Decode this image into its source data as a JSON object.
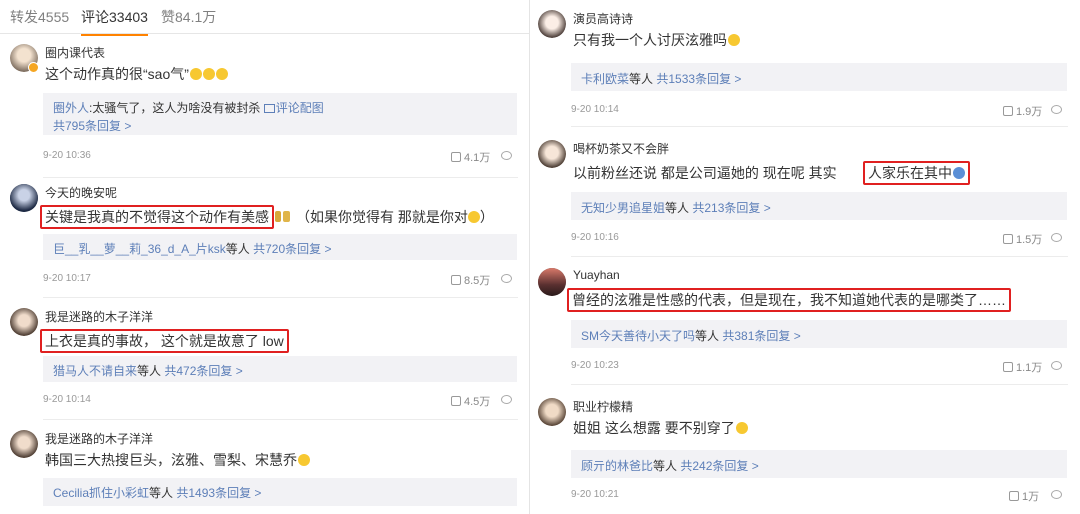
{
  "tabs": [
    {
      "label": "转发4555"
    },
    {
      "label": "评论33403"
    },
    {
      "label": "赞84.1万"
    }
  ],
  "left_comments": [
    {
      "user": "圈内课代表",
      "text": "这个动作真的很“sao气”",
      "replies": {
        "name": "圈外人",
        "text": ":太骚气了，这人为啥没有被封杀",
        "pic": "评论配图",
        "total": "共795条回复"
      },
      "time": "9-20 10:36",
      "likes": "4.1万"
    },
    {
      "user": "今天的晚安呢",
      "text_highlight": "关键是我真的不觉得这个动作有美感",
      "text_rest": "（如果你觉得有 那就是你对",
      "close_paren": "）",
      "replies": {
        "name": "巨__乳__萝__莉_36_d_A_片ksk",
        "suffix": "等人",
        "total": "共720条回复"
      },
      "time": "9-20 10:17",
      "likes": "8.5万"
    },
    {
      "user": "我是迷路的木子洋洋",
      "text_highlight": "上衣是真的事故， 这个就是故意了 low",
      "replies": {
        "name": "猎马人不请自来",
        "suffix": "等人",
        "total": "共472条回复"
      },
      "time": "9-20 10:14",
      "likes": "4.5万"
    },
    {
      "user": "我是迷路的木子洋洋",
      "text": "韩国三大热搜巨头，泫雅、雪梨、宋慧乔",
      "replies": {
        "name": "Cecilia抓住小彩虹",
        "suffix": "等人",
        "total": "共1493条回复"
      }
    }
  ],
  "right_comments": [
    {
      "user": "演员高诗诗",
      "text": "只有我一个人讨厌泫雅吗",
      "replies": {
        "name": "卡利欧菜",
        "suffix": "等人",
        "total": "共1533条回复"
      },
      "time": "9-20 10:14",
      "likes": "1.9万"
    },
    {
      "user": "喝杯奶茶又不会胖",
      "text": "以前粉丝还说 都是公司逼她的 现在呢 其实",
      "text_highlight": "人家乐在其中",
      "replies": {
        "name": "无知少男追星姐",
        "suffix": "等人",
        "total": "共213条回复"
      },
      "time": "9-20 10:16",
      "likes": "1.5万"
    },
    {
      "user": "Yuayhan",
      "text_highlight": "曾经的泫雅是性感的代表，但是现在，我不知道她代表的是哪类了……",
      "replies": {
        "name": "SM今天善待小天了吗",
        "suffix": "等人",
        "total": "共381条回复"
      },
      "time": "9-20 10:23",
      "likes": "1.1万"
    },
    {
      "user": "职业柠檬精",
      "text": "姐姐 这么想露 要不别穿了",
      "replies": {
        "name": "顾亓的林爸比",
        "suffix": "等人",
        "total": "共242条回复"
      },
      "time": "9-20 10:21",
      "likes": "1万"
    }
  ],
  "colors": {
    "highlight_border": "#e02020",
    "link": "#5d7fb8",
    "tab_accent": "#ff8200",
    "reply_bg": "#f2f2f5"
  }
}
